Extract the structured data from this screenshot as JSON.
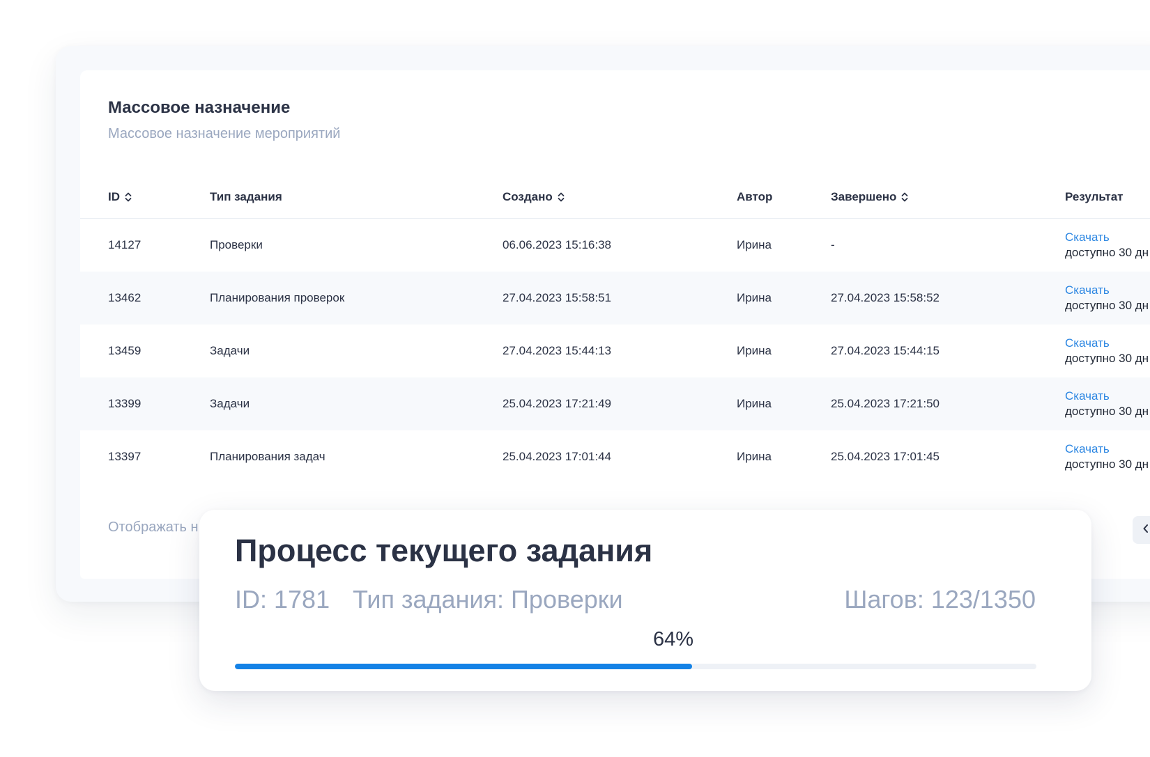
{
  "card": {
    "title": "Массовое назначение",
    "subtitle": "Массовое назначение мероприятий"
  },
  "table": {
    "columns": {
      "id": "ID",
      "type": "Тип задания",
      "created": "Создано",
      "author": "Автор",
      "done": "Завершено",
      "result": "Результат"
    },
    "rows": [
      {
        "id": "14127",
        "type": "Проверки",
        "created": "06.06.2023 15:16:38",
        "author": "Ирина",
        "done": "-",
        "link": "Скачать",
        "note": "доступно 30 дн"
      },
      {
        "id": "13462",
        "type": "Планирования проверок",
        "created": "27.04.2023 15:58:51",
        "author": "Ирина",
        "done": "27.04.2023 15:58:52",
        "link": "Скачать",
        "note": "доступно 30 дн"
      },
      {
        "id": "13459",
        "type": "Задачи",
        "created": "27.04.2023 15:44:13",
        "author": "Ирина",
        "done": "27.04.2023 15:44:15",
        "link": "Скачать",
        "note": "доступно 30 дн"
      },
      {
        "id": "13399",
        "type": "Задачи",
        "created": "25.04.2023 17:21:49",
        "author": "Ирина",
        "done": "25.04.2023 17:21:50",
        "link": "Скачать",
        "note": "доступно 30 дн"
      },
      {
        "id": "13397",
        "type": "Планирования задач",
        "created": "25.04.2023 17:01:44",
        "author": "Ирина",
        "done": "25.04.2023 17:01:45",
        "link": "Скачать",
        "note": "доступно 30 дн"
      }
    ]
  },
  "footer": {
    "display_label": "Отображать н",
    "pager_icon": "chevron-left-icon"
  },
  "progress": {
    "title": "Процесс текущего задания",
    "id_text": "ID: 1781",
    "type_text": "Тип задания: Проверки",
    "steps_text": "Шагов: 123/1350",
    "percent_text": "64%",
    "fraction": 0.57
  },
  "colors": {
    "accent": "#1482e6",
    "link": "#2d87e2",
    "text": "#2b3245",
    "muted": "#9aa7bf",
    "row_alt": "#f7f9fc"
  }
}
